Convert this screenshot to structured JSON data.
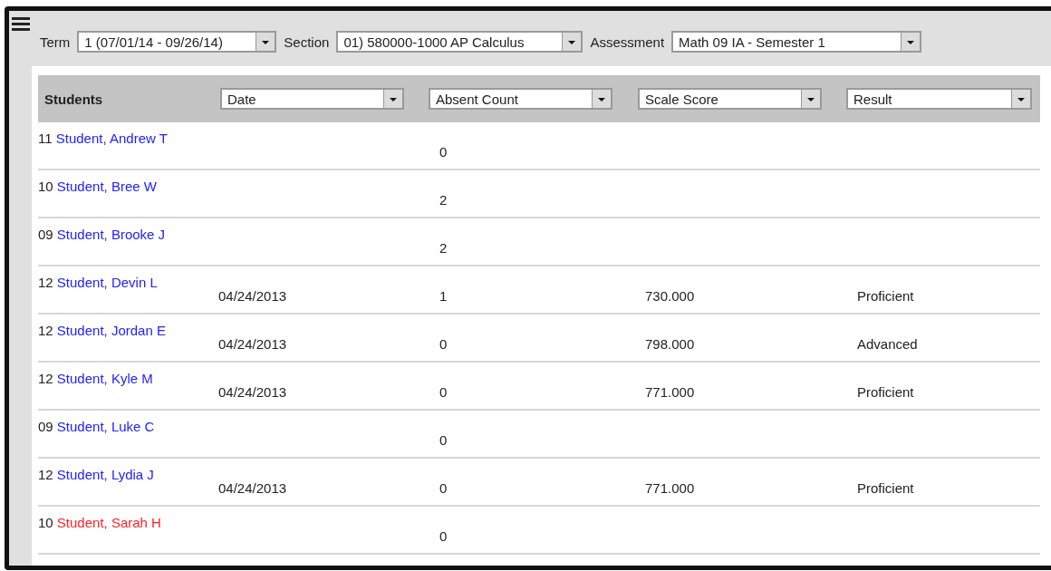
{
  "filters": [
    {
      "label": "Term",
      "value": "1 (07/01/14 - 09/26/14)"
    },
    {
      "label": "Section",
      "value": "01) 580000-1000 AP Calculus"
    },
    {
      "label": "Assessment",
      "value": "Math 09 IA - Semester 1"
    }
  ],
  "table": {
    "title": "Students",
    "columns": [
      "Date",
      "Absent Count",
      "Scale Score",
      "Result"
    ],
    "rows": [
      {
        "grade": "11",
        "name": "Student, Andrew T",
        "color": "#2222ff",
        "cells": [
          "",
          "0",
          "",
          ""
        ]
      },
      {
        "grade": "10",
        "name": "Student, Bree W",
        "color": "#2222ff",
        "cells": [
          "",
          "2",
          "",
          ""
        ]
      },
      {
        "grade": "09",
        "name": "Student, Brooke J",
        "color": "#2222ff",
        "cells": [
          "",
          "2",
          "",
          ""
        ]
      },
      {
        "grade": "12",
        "name": "Student, Devin L",
        "color": "#2222ff",
        "cells": [
          "04/24/2013",
          "1",
          "730.000",
          "Proficient"
        ]
      },
      {
        "grade": "12",
        "name": "Student, Jordan E",
        "color": "#2222ff",
        "cells": [
          "04/24/2013",
          "0",
          "798.000",
          "Advanced"
        ]
      },
      {
        "grade": "12",
        "name": "Student, Kyle M",
        "color": "#2222ff",
        "cells": [
          "04/24/2013",
          "0",
          "771.000",
          "Proficient"
        ]
      },
      {
        "grade": "09",
        "name": "Student, Luke C",
        "color": "#2222ff",
        "cells": [
          "",
          "0",
          "",
          ""
        ]
      },
      {
        "grade": "12",
        "name": "Student, Lydia J",
        "color": "#2222ff",
        "cells": [
          "04/24/2013",
          "0",
          "771.000",
          "Proficient"
        ]
      },
      {
        "grade": "10",
        "name": "Student, Sarah H",
        "color": "#ff2222",
        "cells": [
          "",
          "0",
          "",
          ""
        ]
      }
    ]
  }
}
